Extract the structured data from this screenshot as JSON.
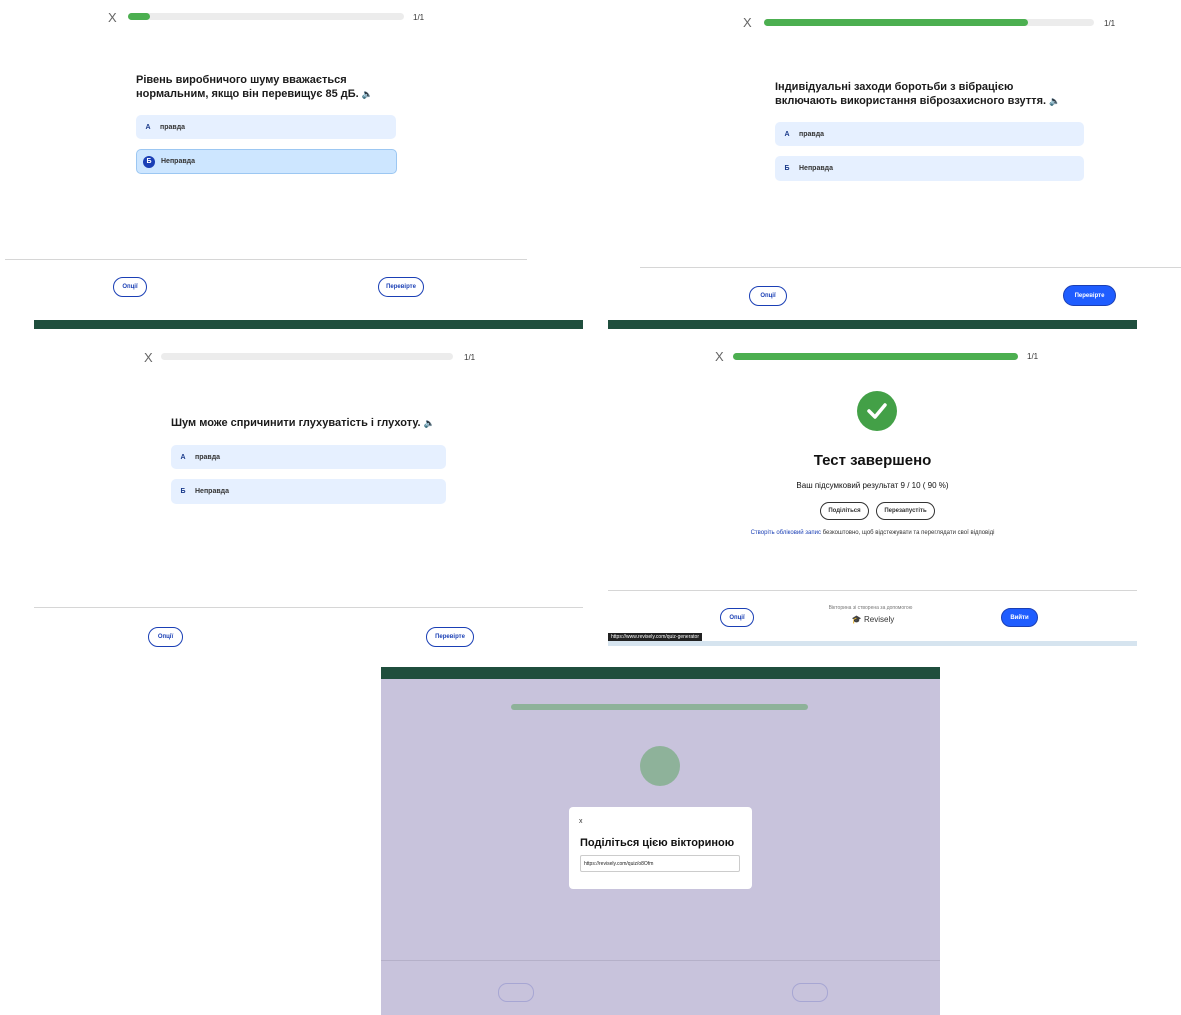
{
  "quiz1": {
    "close": "X",
    "progress": 0.08,
    "counter": "1/1",
    "question": "Рівень виробничого шуму вважається нормальним, якщо він перевищує 85 дБ.",
    "speaker": "🔈",
    "options": [
      {
        "letter": "A",
        "text": "правда"
      },
      {
        "letter": "Б",
        "text": "Неправда",
        "selected": true
      }
    ],
    "options_btn": "Опції",
    "check_btn": "Перевірте"
  },
  "quiz2": {
    "close": "X",
    "progress": 0.8,
    "counter": "1/1",
    "question": "Індивідуальні заходи боротьби з вібрацією включають використання віброзахисного взуття.",
    "speaker": "🔈",
    "options": [
      {
        "letter": "A",
        "text": "правда"
      },
      {
        "letter": "Б",
        "text": "Неправда"
      }
    ],
    "options_btn": "Опції",
    "check_btn": "Перевірте"
  },
  "quiz3": {
    "close": "X",
    "progress": 0.0,
    "counter": "1/1",
    "question": "Шум може спричинити глухуватість і глухоту.",
    "speaker": "🔈",
    "options": [
      {
        "letter": "A",
        "text": "правда"
      },
      {
        "letter": "Б",
        "text": "Неправда"
      }
    ],
    "options_btn": "Опції",
    "check_btn": "Перевірте"
  },
  "result": {
    "close": "X",
    "progress": 1.0,
    "counter": "1/1",
    "title": "Тест завершено",
    "score": "Ваш підсумковий результат 9 / 10 ( 90 %)",
    "share_btn": "Поділіться",
    "restart_btn": "Перезапустіть",
    "signup_link": "Створіть обліковий запис",
    "signup_rest": " безкоштовно, щоб відстежувати та переглядати свої відповіді",
    "options_btn": "Опції",
    "footer_caption": "Вікторина зі створена за допомогою",
    "brand": "Revisely",
    "exit_btn": "Вийти",
    "status_url": "https://www.revisely.com/quiz-generator"
  },
  "share_modal": {
    "close": "x",
    "title": "Поділіться цією вікториною",
    "url": "https://revisely.com/quiz/o8Ofm"
  },
  "colors": {
    "accent": "#1a3fb5",
    "progress_green": "#4caf50",
    "option_bg": "#e6f0ff",
    "overlay": "#c8c3dc"
  }
}
